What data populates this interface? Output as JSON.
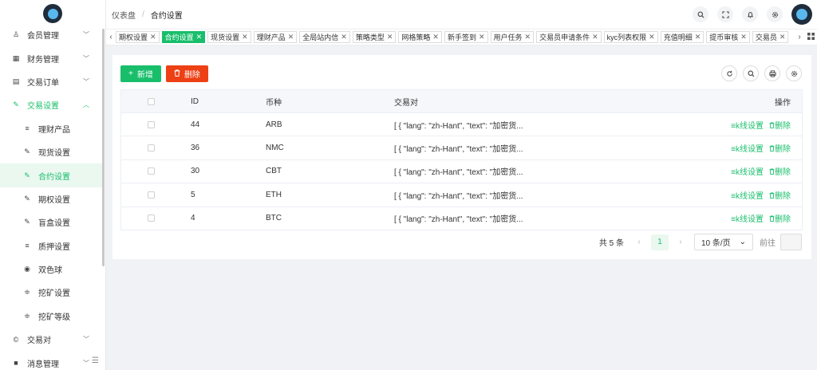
{
  "colors": {
    "primary": "#19be6b",
    "danger": "#ed4014"
  },
  "sidebar": {
    "items": [
      {
        "label": "会员管理",
        "icon": "user-icon"
      },
      {
        "label": "财务管理",
        "icon": "finance-icon"
      },
      {
        "label": "交易订单",
        "icon": "order-icon"
      },
      {
        "label": "交易设置",
        "icon": "wrench-icon",
        "open": true
      },
      {
        "label": "理财产品",
        "icon": "list-icon",
        "sub": true
      },
      {
        "label": "现货设置",
        "icon": "wrench-icon",
        "sub": true
      },
      {
        "label": "合约设置",
        "icon": "wrench-icon",
        "sub": true,
        "active": true
      },
      {
        "label": "期权设置",
        "icon": "wrench-icon",
        "sub": true
      },
      {
        "label": "盲盒设置",
        "icon": "wrench-icon",
        "sub": true
      },
      {
        "label": "质押设置",
        "icon": "list-icon",
        "sub": true
      },
      {
        "label": "双色球",
        "icon": "target-icon",
        "sub": true
      },
      {
        "label": "挖矿设置",
        "icon": "sliders-icon",
        "sub": true
      },
      {
        "label": "挖矿等级",
        "icon": "sliders-icon",
        "sub": true
      },
      {
        "label": "交易对",
        "icon": "copyright-icon"
      },
      {
        "label": "消息管理",
        "icon": "message-icon"
      }
    ]
  },
  "header": {
    "breadcrumb_home": "仪表盘",
    "breadcrumb_sep": "/",
    "breadcrumb_current": "合约设置"
  },
  "tabs": [
    {
      "label": "期权设置"
    },
    {
      "label": "合约设置",
      "active": true
    },
    {
      "label": "现货设置"
    },
    {
      "label": "理财产品"
    },
    {
      "label": "全局站内信"
    },
    {
      "label": "策略类型"
    },
    {
      "label": "网格策略"
    },
    {
      "label": "新手签到"
    },
    {
      "label": "用户任务"
    },
    {
      "label": "交易员申请条件"
    },
    {
      "label": "kyc列表权限"
    },
    {
      "label": "充值明细"
    },
    {
      "label": "提币审核"
    },
    {
      "label": "交易员"
    }
  ],
  "toolbar": {
    "add_label": "新增",
    "delete_label": "删除"
  },
  "table": {
    "headers": {
      "id": "ID",
      "coin": "币种",
      "pair": "交易对",
      "op": "操作"
    },
    "op_kline": "≡k线设置",
    "op_delete": "删除",
    "rows": [
      {
        "id": "44",
        "coin": "ARB",
        "pair": "[ { \"lang\": \"zh-Hant\", \"text\": \"加密货..."
      },
      {
        "id": "36",
        "coin": "NMC",
        "pair": "[ { \"lang\": \"zh-Hant\", \"text\": \"加密货..."
      },
      {
        "id": "30",
        "coin": "CBT",
        "pair": "[ { \"lang\": \"zh-Hant\", \"text\": \"加密货..."
      },
      {
        "id": "5",
        "coin": "ETH",
        "pair": "[ { \"lang\": \"zh-Hant\", \"text\": \"加密货..."
      },
      {
        "id": "4",
        "coin": "BTC",
        "pair": "[ { \"lang\": \"zh-Hant\", \"text\": \"加密货..."
      }
    ]
  },
  "pagination": {
    "total": "共 5 条",
    "current_page": "1",
    "page_size": "10 条/页",
    "goto_label": "前往"
  }
}
